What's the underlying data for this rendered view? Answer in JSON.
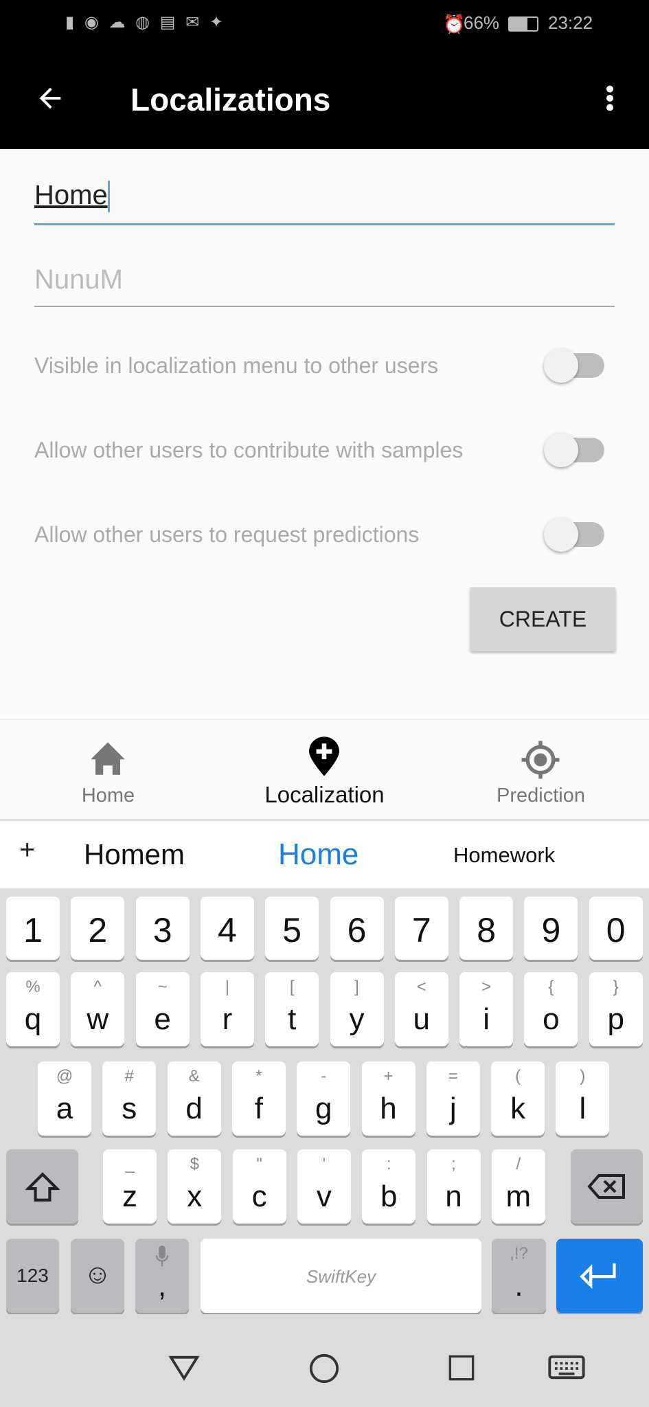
{
  "status_bar": {
    "battery": "66%",
    "time": "23:22",
    "left_icons": [
      "signal-icon",
      "wifi-icon",
      "cloud-icon",
      "messenger-icon",
      "news-icon",
      "mail-icon",
      "twitter-icon"
    ]
  },
  "app_bar": {
    "title": "Localizations"
  },
  "form": {
    "name_value": "Home",
    "description_placeholder": "NunuM",
    "toggles": [
      {
        "label": "Visible in localization menu to other users",
        "on": false
      },
      {
        "label": "Allow other users to contribute with samples",
        "on": false
      },
      {
        "label": "Allow other users to request predictions",
        "on": false
      }
    ],
    "create_label": "CREATE"
  },
  "bottom_nav": {
    "items": [
      {
        "label": "Home",
        "icon": "home-icon",
        "active": false
      },
      {
        "label": "Localization",
        "icon": "add-location-icon",
        "active": true
      },
      {
        "label": "Prediction",
        "icon": "target-icon",
        "active": false
      }
    ]
  },
  "suggestions": {
    "left": "Homem",
    "center": "Home",
    "right": "Homework",
    "accent": "#1a7fe0"
  },
  "keyboard": {
    "numbers": [
      "1",
      "2",
      "3",
      "4",
      "5",
      "6",
      "7",
      "8",
      "9",
      "0"
    ],
    "row1": [
      [
        "q",
        "%"
      ],
      [
        "w",
        "^"
      ],
      [
        "e",
        "~"
      ],
      [
        "r",
        "|"
      ],
      [
        "t",
        "["
      ],
      [
        "y",
        "]"
      ],
      [
        "u",
        "<"
      ],
      [
        "i",
        ">"
      ],
      [
        "o",
        "{"
      ],
      [
        "p",
        "}"
      ]
    ],
    "row2": [
      [
        "a",
        "@"
      ],
      [
        "s",
        "#"
      ],
      [
        "d",
        "&"
      ],
      [
        "f",
        "*"
      ],
      [
        "g",
        "-"
      ],
      [
        "h",
        "+"
      ],
      [
        "j",
        "="
      ],
      [
        "k",
        "("
      ],
      [
        "l",
        ")"
      ]
    ],
    "row3": [
      [
        "z",
        "_"
      ],
      [
        "x",
        "$"
      ],
      [
        "c",
        "\""
      ],
      [
        "v",
        "'"
      ],
      [
        "b",
        ":"
      ],
      [
        "n",
        ";"
      ],
      [
        "m",
        "/"
      ]
    ],
    "symbols_label": "123",
    "comma": ",",
    "period": ".",
    "period_alt": ",!?",
    "space_brand": "SwiftKey",
    "enter_color": "#1a7fe8"
  }
}
